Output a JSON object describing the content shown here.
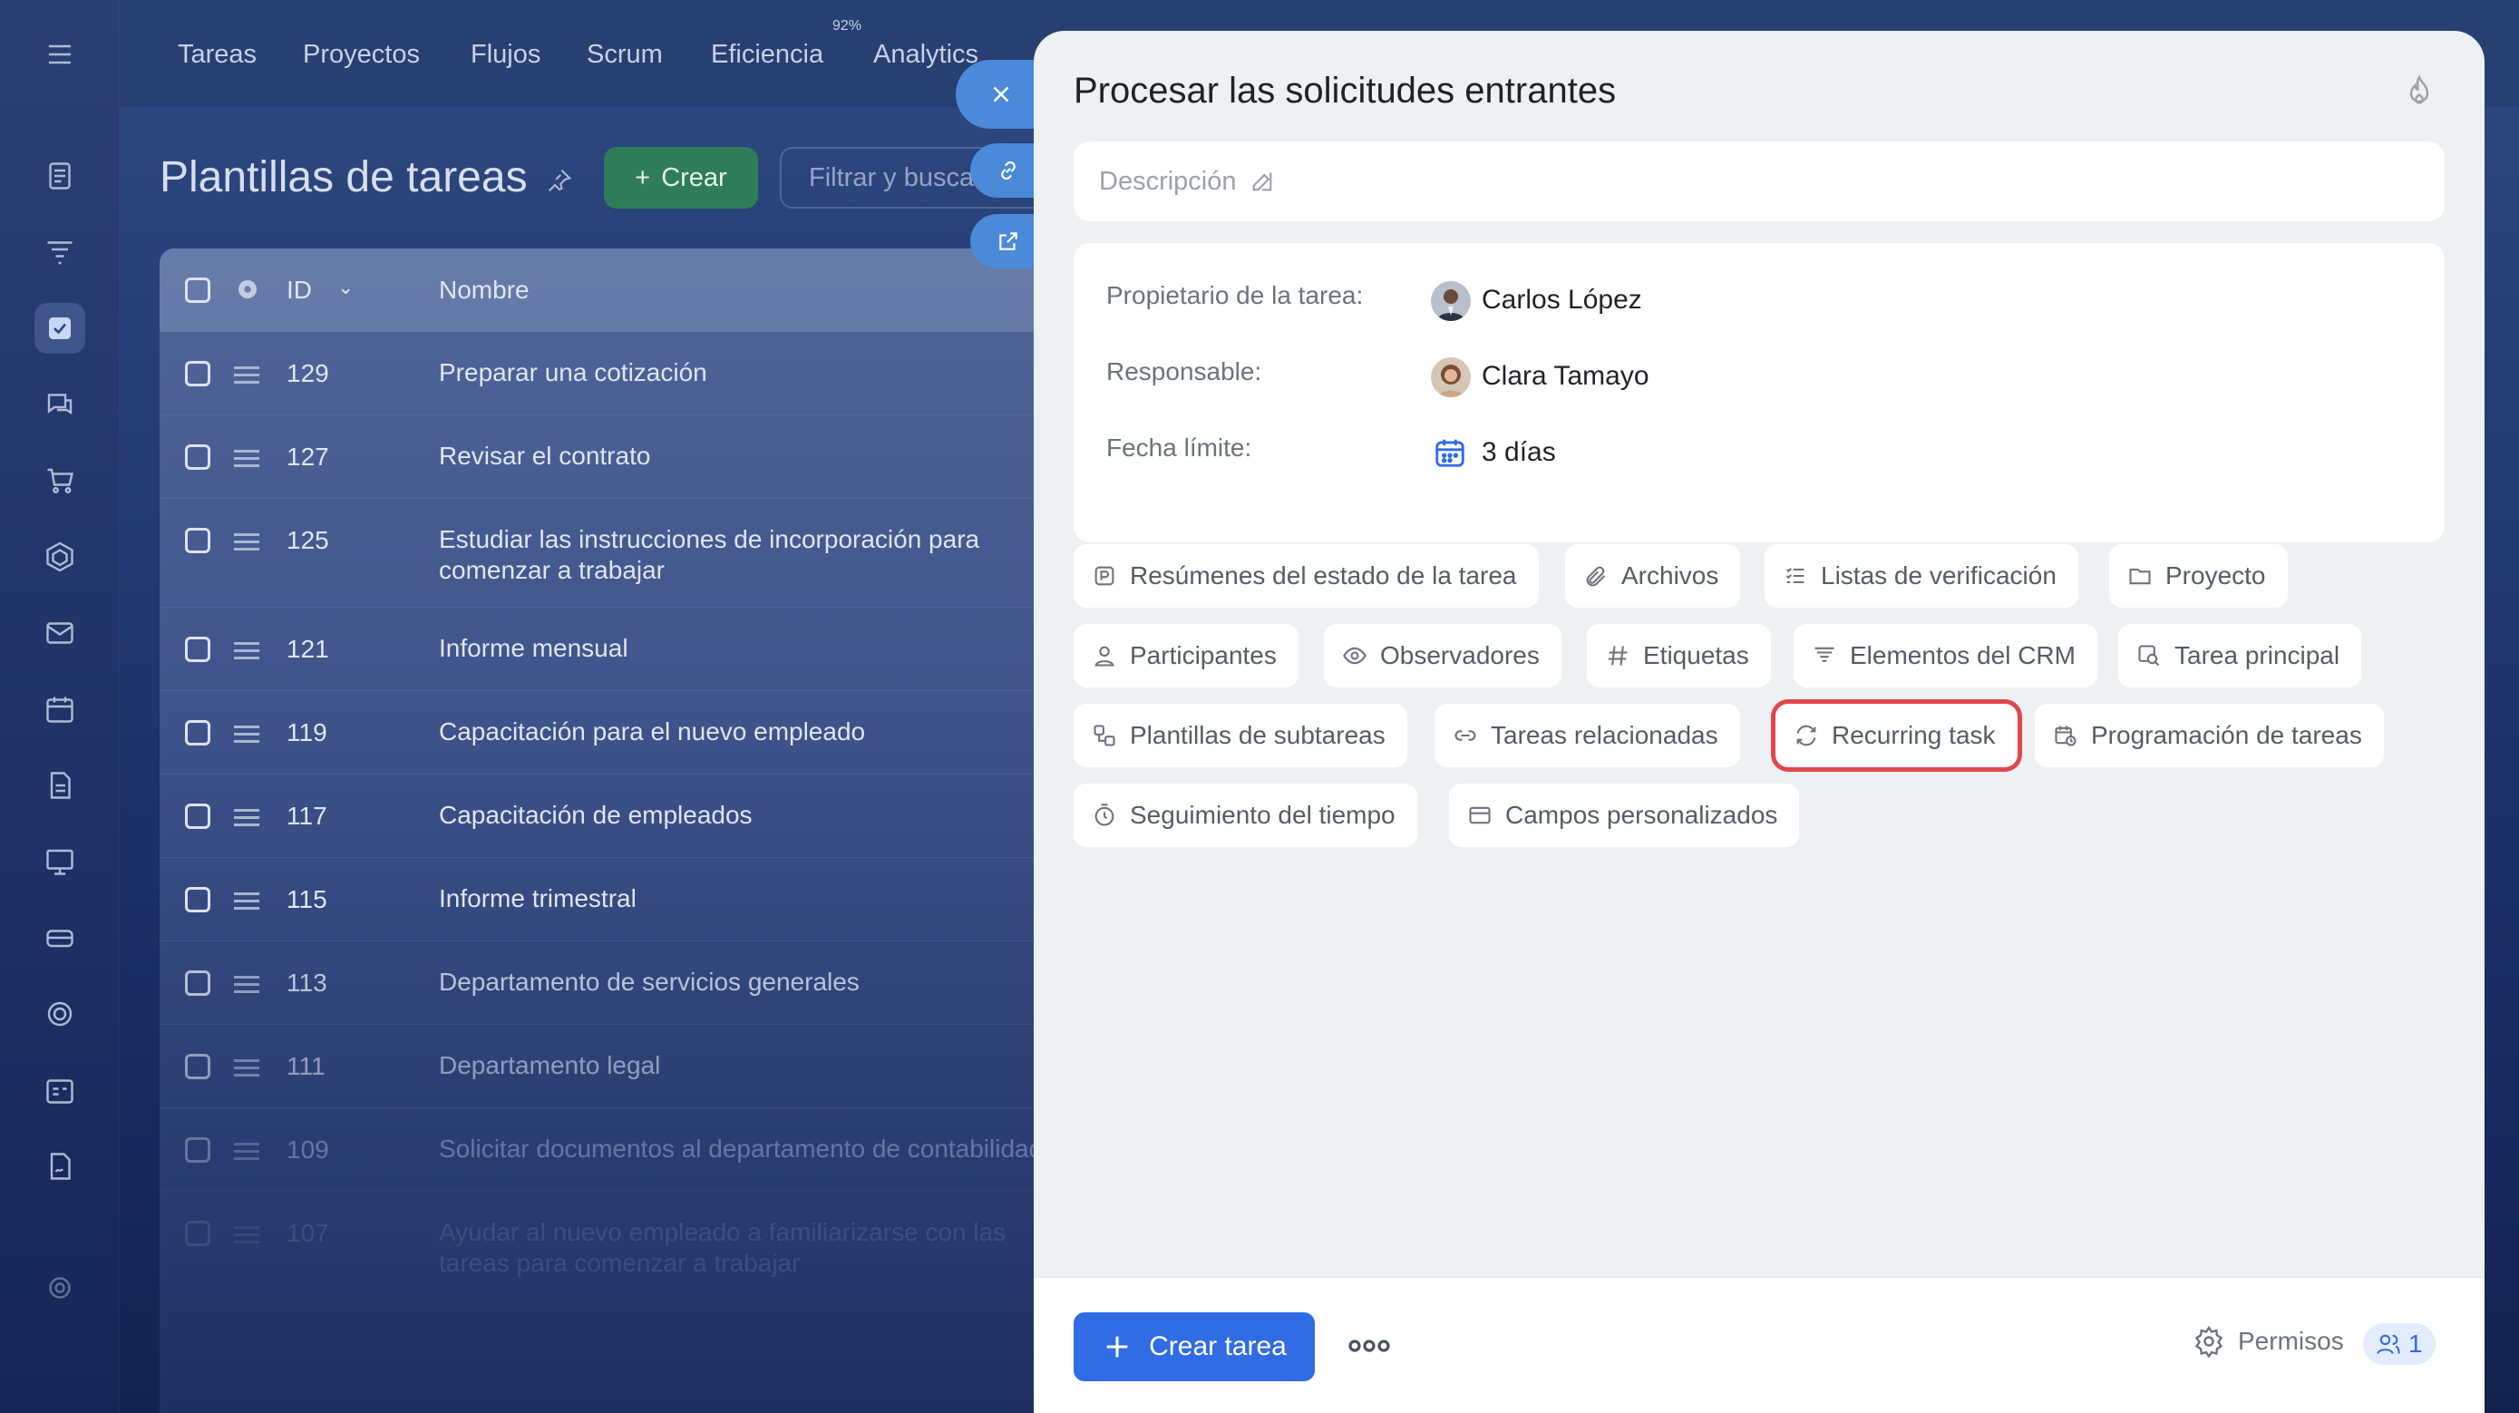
{
  "topnav": {
    "items": [
      "Tareas",
      "Proyectos",
      "Flujos",
      "Scrum",
      "Eficiencia",
      "Analytics"
    ],
    "efficiency_badge": "92%"
  },
  "page": {
    "title": "Plantillas de tareas",
    "create_label": "Crear",
    "filter_placeholder": "Filtrar y buscar"
  },
  "grid": {
    "columns": [
      "ID",
      "Nombre"
    ],
    "rows": [
      {
        "id": "129",
        "name": "Preparar una cotización"
      },
      {
        "id": "127",
        "name": "Revisar el contrato"
      },
      {
        "id": "125",
        "name": "Estudiar las instrucciones de incorporación para comenzar a trabajar"
      },
      {
        "id": "121",
        "name": "Informe mensual"
      },
      {
        "id": "119",
        "name": "Capacitación para el nuevo empleado"
      },
      {
        "id": "117",
        "name": "Capacitación de empleados"
      },
      {
        "id": "115",
        "name": "Informe trimestral"
      },
      {
        "id": "113",
        "name": "Departamento de servicios generales"
      },
      {
        "id": "111",
        "name": "Departamento legal"
      },
      {
        "id": "109",
        "name": "Solicitar documentos al departamento de contabilidad"
      },
      {
        "id": "107",
        "name": "Ayudar al nuevo empleado a familiarizarse con las tareas para comenzar a trabajar"
      }
    ]
  },
  "panel": {
    "title": "Procesar las solicitudes entrantes",
    "description_placeholder": "Descripción",
    "owner_label": "Propietario de la tarea:",
    "owner_name": "Carlos López",
    "responsible_label": "Responsable:",
    "responsible_name": "Clara Tamayo",
    "deadline_label": "Fecha límite:",
    "deadline_value": "3 días",
    "chips": [
      "Resúmenes del estado de la tarea",
      "Archivos",
      "Listas de verificación",
      "Proyecto",
      "Participantes",
      "Observadores",
      "Etiquetas",
      "Elementos del CRM",
      "Tarea principal",
      "Plantillas de subtareas",
      "Tareas relacionadas",
      "Recurring task",
      "Programación de tareas",
      "Seguimiento del tiempo",
      "Campos personalizados"
    ],
    "highlighted_chip": "Recurring task",
    "highlight_color": "#e0474c"
  },
  "footer": {
    "create_task_label": "Crear tarea",
    "permissions_label": "Permisos",
    "users_count": "1"
  },
  "colors": {
    "primary": "#2f6ce5",
    "create_green": "#2e7d58",
    "panel_bg": "#eef1f4"
  }
}
